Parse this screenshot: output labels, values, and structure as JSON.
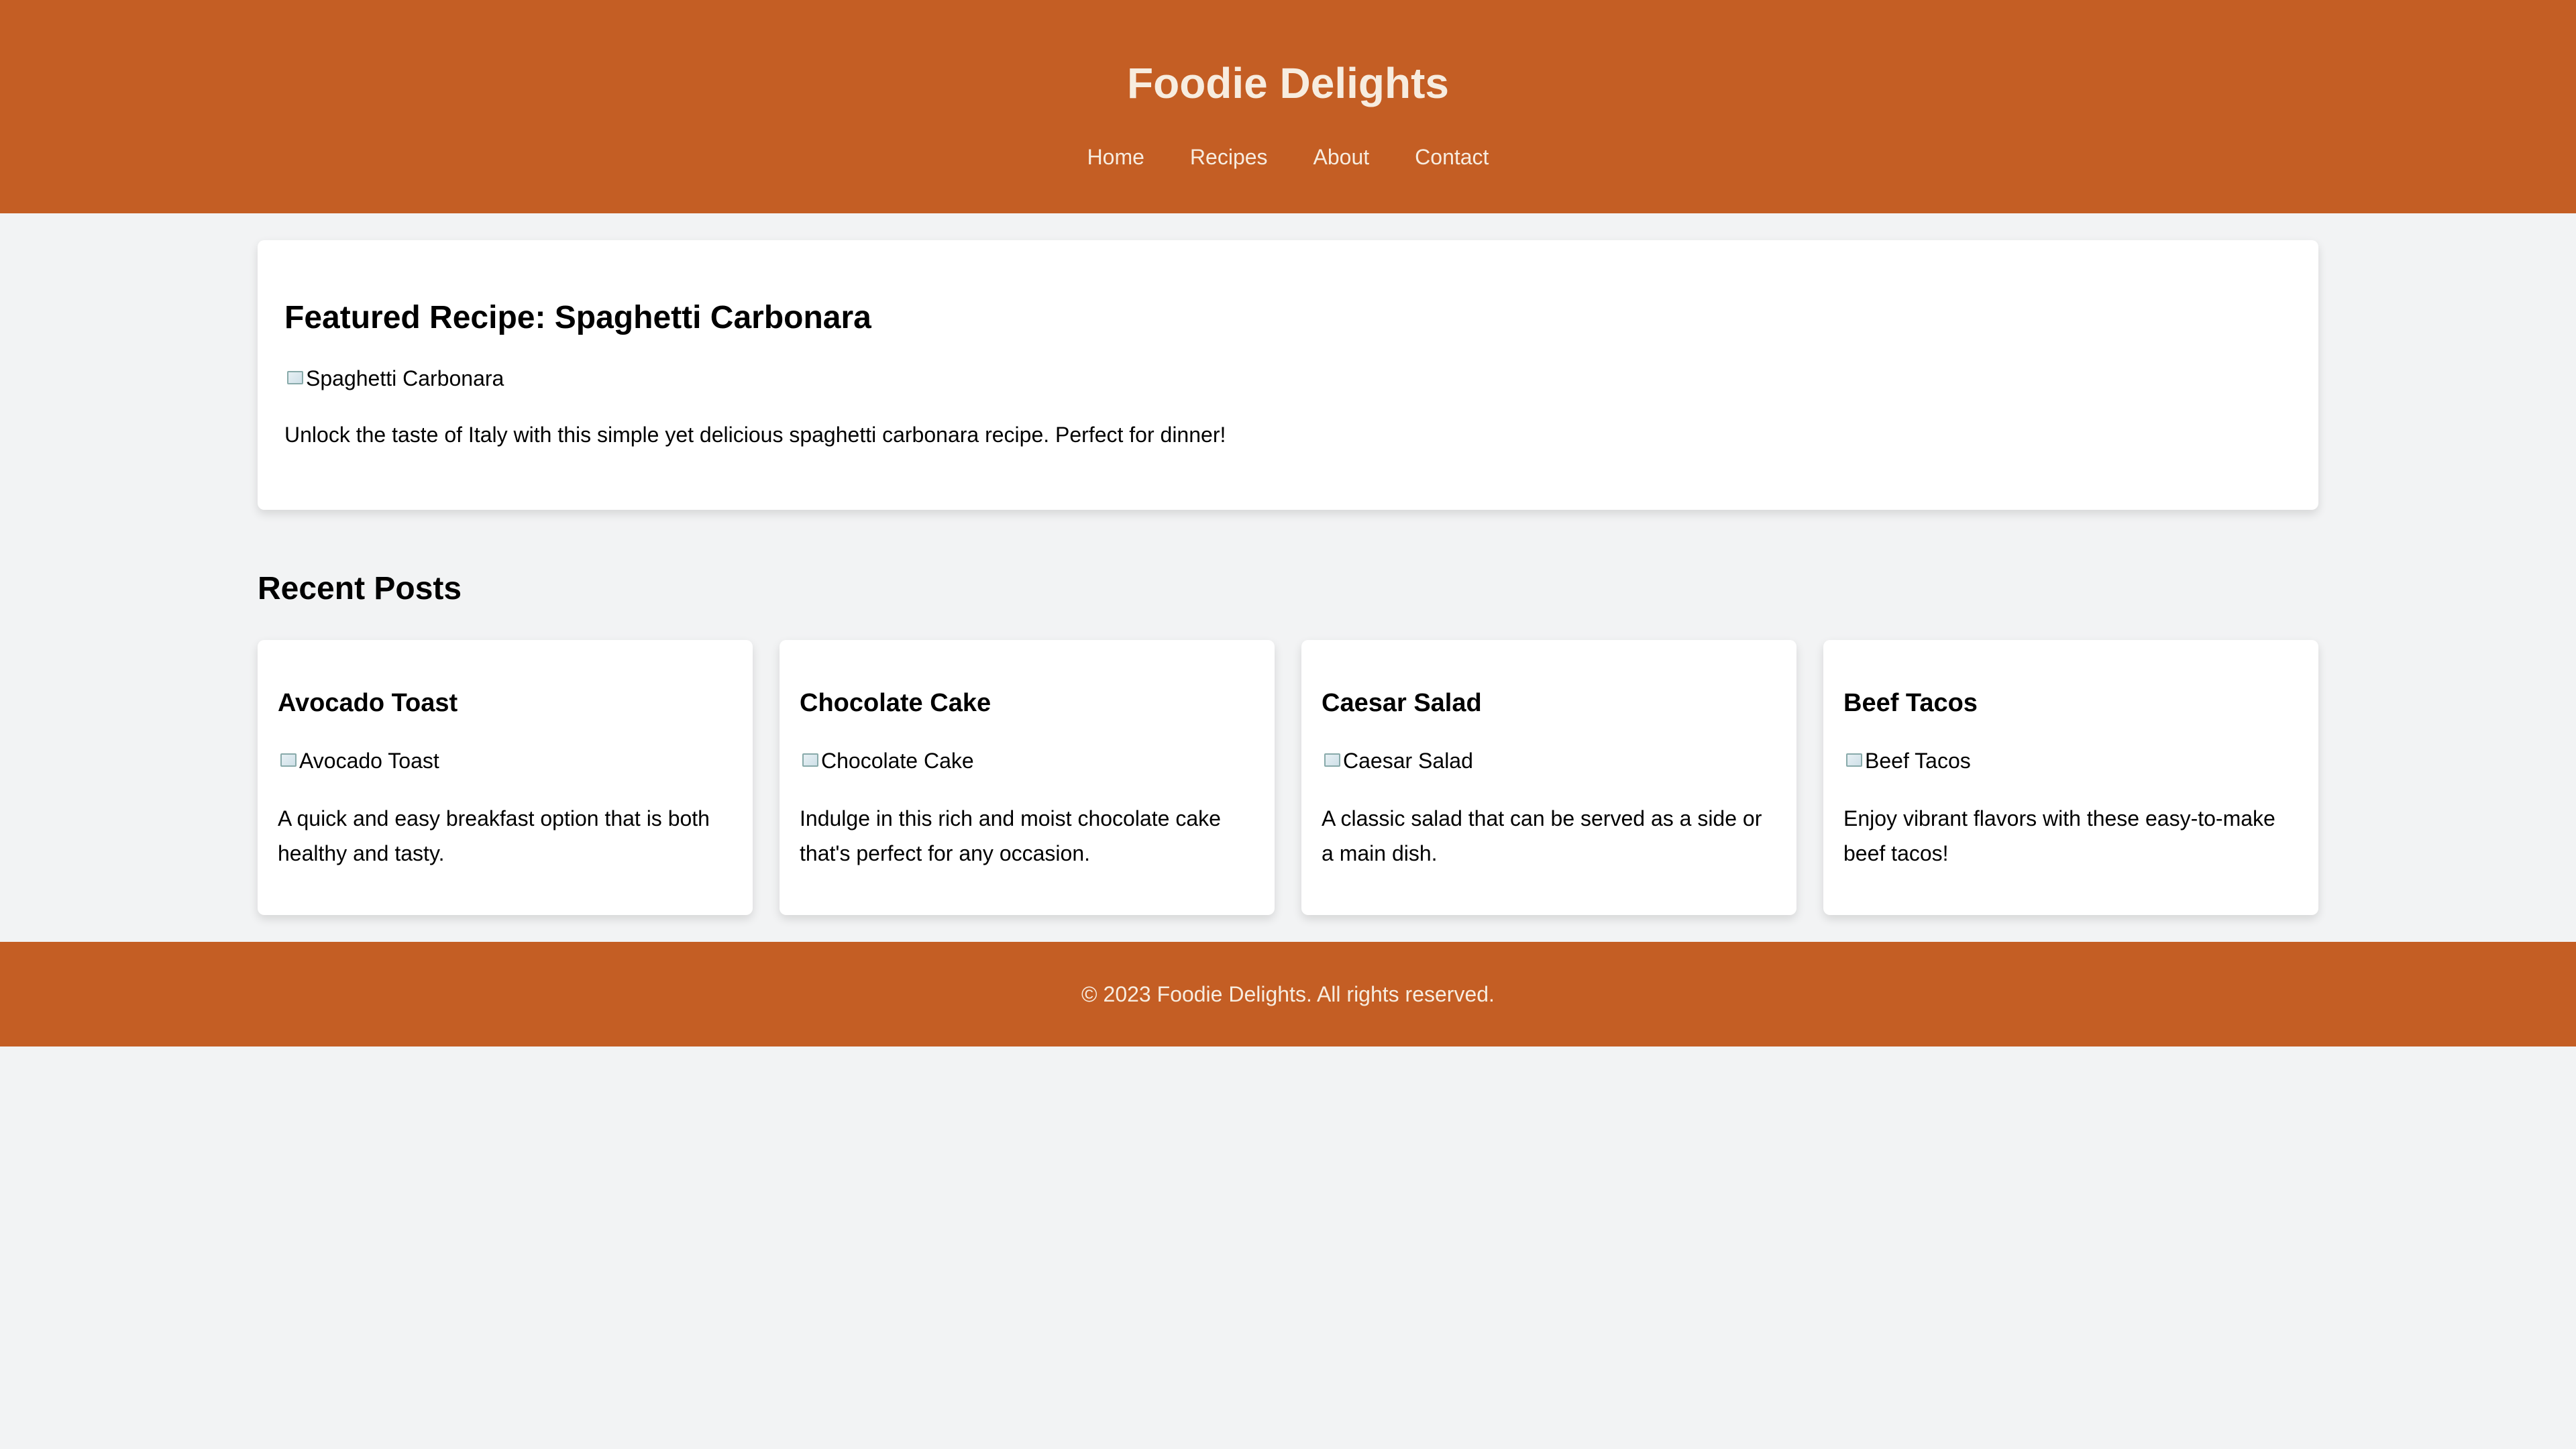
{
  "header": {
    "site_title": "Foodie Delights",
    "nav": [
      {
        "label": "Home"
      },
      {
        "label": "Recipes"
      },
      {
        "label": "About"
      },
      {
        "label": "Contact"
      }
    ]
  },
  "featured": {
    "title": "Featured Recipe: Spaghetti Carbonara",
    "image_alt": "Spaghetti Carbonara",
    "description": "Unlock the taste of Italy with this simple yet delicious spaghetti carbonara recipe. Perfect for dinner!"
  },
  "recent": {
    "heading": "Recent Posts",
    "posts": [
      {
        "title": "Avocado Toast",
        "image_alt": "Avocado Toast",
        "description": "A quick and easy breakfast option that is both healthy and tasty."
      },
      {
        "title": "Chocolate Cake",
        "image_alt": "Chocolate Cake",
        "description": "Indulge in this rich and moist chocolate cake that's perfect for any occasion."
      },
      {
        "title": "Caesar Salad",
        "image_alt": "Caesar Salad",
        "description": "A classic salad that can be served as a side or a main dish."
      },
      {
        "title": "Beef Tacos",
        "image_alt": "Beef Tacos",
        "description": "Enjoy vibrant flavors with these easy-to-make beef tacos!"
      }
    ]
  },
  "footer": {
    "copyright": "© 2023 Foodie Delights. All rights reserved."
  },
  "colors": {
    "brand": "#c45e24",
    "brand_text": "#f7ecdf",
    "background": "#f2f3f4",
    "card": "#ffffff"
  }
}
